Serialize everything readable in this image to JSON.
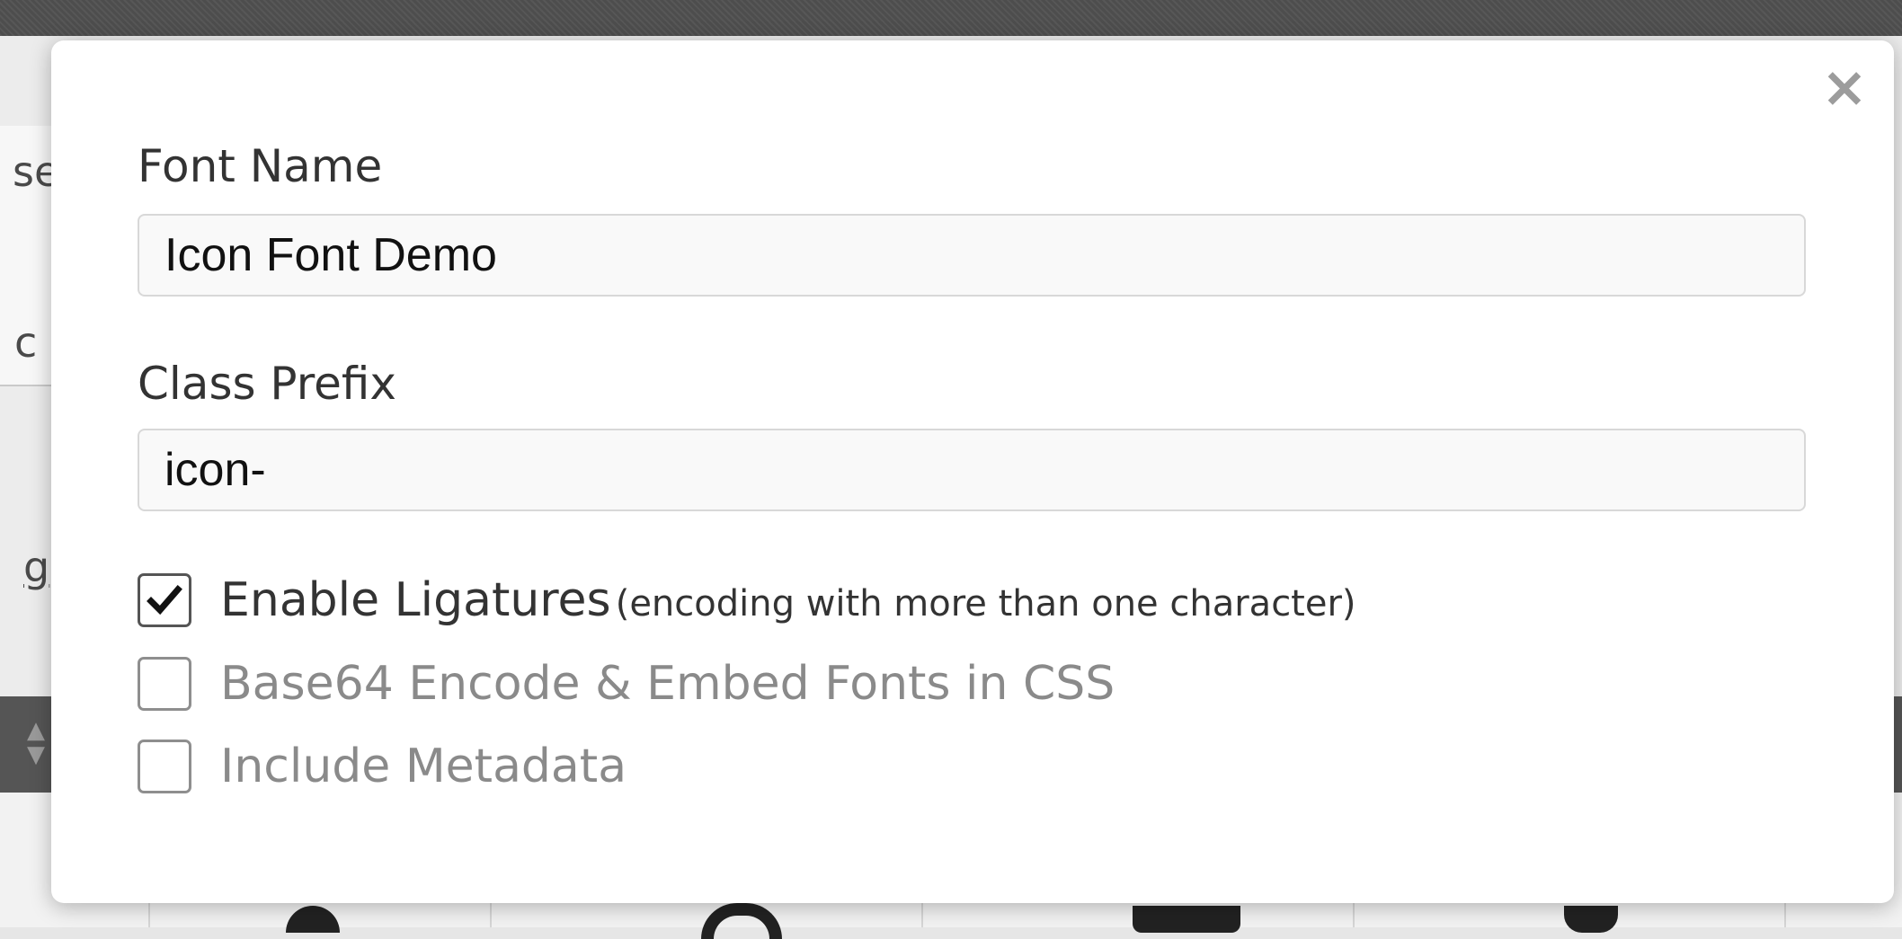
{
  "background": {
    "fragments": [
      "se",
      "c",
      "g"
    ],
    "spinner_up": "▲",
    "spinner_down": "▼"
  },
  "modal": {
    "close_label": "×",
    "font_name": {
      "label": "Font Name",
      "value": "Icon Font Demo"
    },
    "class_prefix": {
      "label": "Class Prefix",
      "value": "icon-"
    },
    "options": [
      {
        "label": "Enable Ligatures",
        "note": "(encoding with more than one character)",
        "checked": true
      },
      {
        "label": "Base64 Encode & Embed Fonts in CSS",
        "note": "",
        "checked": false
      },
      {
        "label": "Include Metadata",
        "note": "",
        "checked": false
      }
    ]
  },
  "colors": {
    "modal_bg": "#ffffff",
    "label_text": "#333333",
    "muted_text": "#8a8a8a",
    "input_bg": "#f9f9f9",
    "input_border": "#d8d8d8"
  }
}
